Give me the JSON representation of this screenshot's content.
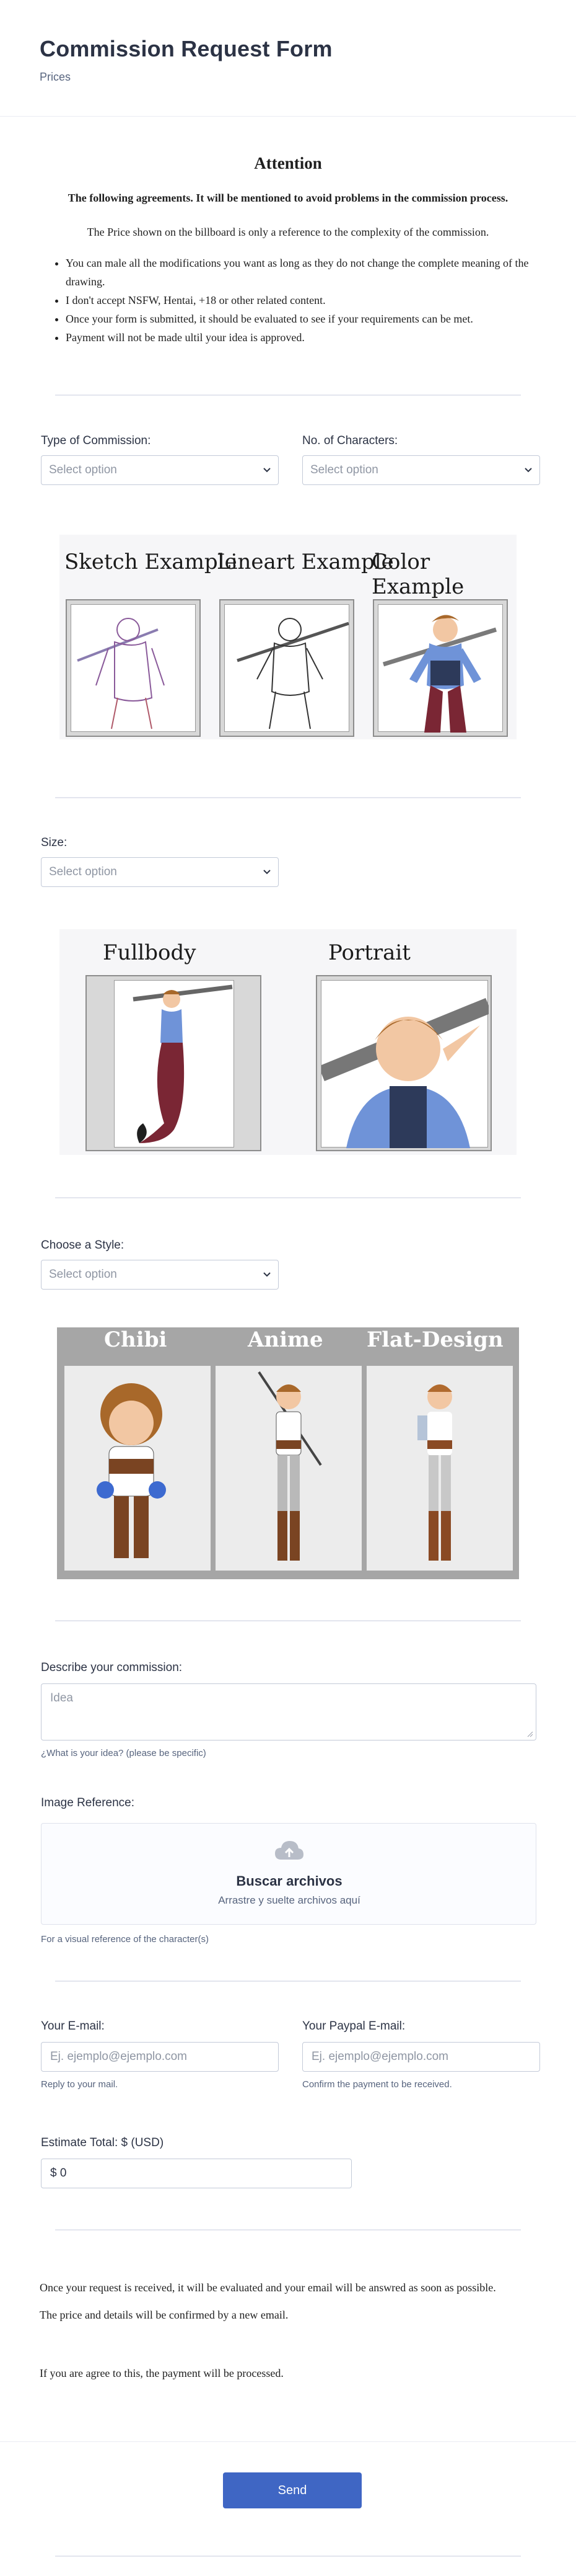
{
  "header": {
    "title": "Commission Request Form",
    "subtitle": "Prices"
  },
  "attention": {
    "title": "Attention",
    "bold_line": "The following agreements. It will be mentioned to avoid problems in the commission process.",
    "price_line": "The Price shown on the billboard is only a reference to the complexity of the commission.",
    "items": [
      "You can male all the modifications you want as long as they do not change the complete meaning of the drawing.",
      "I don't accept NSFW, Hentai, +18 or other related content.",
      "Once your form is submitted, it should be evaluated to see if your requirements can be met.",
      "Payment will not be made ultil your idea is approved."
    ]
  },
  "type_of_commission": {
    "label": "Type of Commission:",
    "placeholder": "Select option"
  },
  "no_characters": {
    "label": "No. of Characters:",
    "placeholder": "Select option"
  },
  "examples": [
    "Sketch Example",
    "Lineart Example",
    "Color Example"
  ],
  "size": {
    "label": "Size:",
    "placeholder": "Select option"
  },
  "size_examples": [
    "Fullbody",
    "Portrait"
  ],
  "style": {
    "label": "Choose a Style:",
    "placeholder": "Select option"
  },
  "style_examples": [
    "Chibi",
    "Anime",
    "Flat-Design"
  ],
  "describe": {
    "label": "Describe your commission:",
    "placeholder": "Idea",
    "hint": "¿What is your idea? (please be specific)"
  },
  "image_reference": {
    "label": "Image Reference:",
    "button": "Buscar archivos",
    "drop": "Arrastre y suelte archivos aquí",
    "hint": "For a visual reference of the character(s)"
  },
  "email": {
    "label": "Your E-mail:",
    "placeholder": "Ej. ejemplo@ejemplo.com",
    "hint": "Reply to your mail."
  },
  "paypal": {
    "label": "Your Paypal E-mail:",
    "placeholder": "Ej. ejemplo@ejemplo.com",
    "hint": "Confirm the payment to be received."
  },
  "estimate": {
    "label": "Estimate Total: $ (USD)",
    "value": "$ 0"
  },
  "closing": {
    "p1": "Once your request is received, it will be evaluated and your email will be answred as soon as possible.",
    "p2": "The price and details will be confirmed by a new email.",
    "p3": "If you are agree to this, the payment will be processed."
  },
  "submit": {
    "label": "Send"
  },
  "colors": {
    "accent": "#3f66c4",
    "border": "#c3cad8",
    "hint": "#57647e"
  }
}
